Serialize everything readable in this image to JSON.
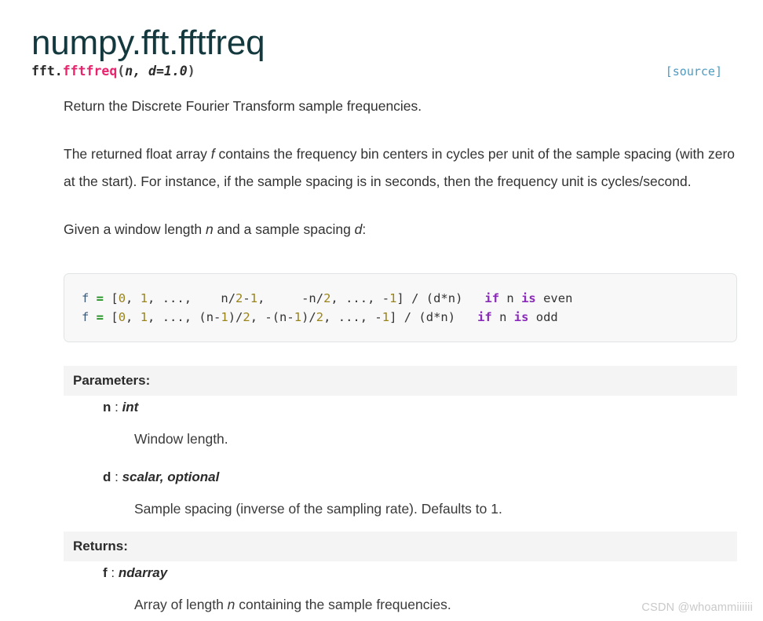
{
  "page": {
    "title": "numpy.fft.fftfreq"
  },
  "signature": {
    "prefix": "fft.",
    "function_name": "fftfreq",
    "open_paren": "(",
    "params": "n, d=1.0",
    "close_paren": ")",
    "source_label": "[source]"
  },
  "body": {
    "paragraphs": [
      {
        "id": "summary",
        "parts": [
          {
            "text": "Return the Discrete Fourier Transform sample frequencies.",
            "style": "normal"
          }
        ]
      },
      {
        "id": "description",
        "parts": [
          {
            "text": "The returned float array ",
            "style": "normal"
          },
          {
            "text": "f",
            "style": "italic"
          },
          {
            "text": " contains the frequency bin centers in cycles per unit of the sample spacing (with zero at the start). For instance, if the sample spacing is in seconds, then the frequency unit is cycles/second.",
            "style": "normal"
          }
        ]
      },
      {
        "id": "given",
        "parts": [
          {
            "text": "Given a window length ",
            "style": "normal"
          },
          {
            "text": "n",
            "style": "italic"
          },
          {
            "text": " and a sample spacing ",
            "style": "normal"
          },
          {
            "text": "d",
            "style": "italic"
          },
          {
            "text": ":",
            "style": "normal"
          }
        ]
      }
    ]
  },
  "code_block": {
    "lines": [
      [
        {
          "t": "f ",
          "c": "name"
        },
        {
          "t": "= ",
          "c": "op"
        },
        {
          "t": "[",
          "c": "plain"
        },
        {
          "t": "0",
          "c": "num"
        },
        {
          "t": ", ",
          "c": "plain"
        },
        {
          "t": "1",
          "c": "num"
        },
        {
          "t": ", ..., ",
          "c": "plain"
        },
        {
          "t": "   n/",
          "c": "plain"
        },
        {
          "t": "2",
          "c": "num"
        },
        {
          "t": "-",
          "c": "plain"
        },
        {
          "t": "1",
          "c": "num"
        },
        {
          "t": ",     -n/",
          "c": "plain"
        },
        {
          "t": "2",
          "c": "num"
        },
        {
          "t": ", ..., -",
          "c": "plain"
        },
        {
          "t": "1",
          "c": "num"
        },
        {
          "t": "] / (d*n)   ",
          "c": "plain"
        },
        {
          "t": "if",
          "c": "kw"
        },
        {
          "t": " n ",
          "c": "plain"
        },
        {
          "t": "is",
          "c": "kw"
        },
        {
          "t": " even",
          "c": "plain"
        }
      ],
      [
        {
          "t": "f ",
          "c": "name"
        },
        {
          "t": "= ",
          "c": "op"
        },
        {
          "t": "[",
          "c": "plain"
        },
        {
          "t": "0",
          "c": "num"
        },
        {
          "t": ", ",
          "c": "plain"
        },
        {
          "t": "1",
          "c": "num"
        },
        {
          "t": ", ..., (n-",
          "c": "plain"
        },
        {
          "t": "1",
          "c": "num"
        },
        {
          "t": ")/",
          "c": "plain"
        },
        {
          "t": "2",
          "c": "num"
        },
        {
          "t": ", -(n-",
          "c": "plain"
        },
        {
          "t": "1",
          "c": "num"
        },
        {
          "t": ")/",
          "c": "plain"
        },
        {
          "t": "2",
          "c": "num"
        },
        {
          "t": ", ..., -",
          "c": "plain"
        },
        {
          "t": "1",
          "c": "num"
        },
        {
          "t": "] / (d*n)   ",
          "c": "plain"
        },
        {
          "t": "if",
          "c": "kw"
        },
        {
          "t": " n ",
          "c": "plain"
        },
        {
          "t": "is",
          "c": "kw"
        },
        {
          "t": " odd",
          "c": "plain"
        }
      ]
    ],
    "plain_text_line_1": "f = [0, 1, ...,   n/2-1,     -n/2, ..., -1] / (d*n)   if n is even",
    "plain_text_line_2": "f = [0, 1, ..., (n-1)/2, -(n-1)/2, ..., -1] / (d*n)   if n is odd"
  },
  "parameters": {
    "heading": "Parameters:",
    "items": [
      {
        "name": "n",
        "separator": ":",
        "type": "int",
        "description_parts": [
          {
            "text": "Window length.",
            "style": "normal"
          }
        ]
      },
      {
        "name": "d",
        "separator": ":",
        "type": "scalar, optional",
        "description_parts": [
          {
            "text": "Sample spacing (inverse of the sampling rate). Defaults to 1.",
            "style": "normal"
          }
        ]
      }
    ]
  },
  "returns": {
    "heading": "Returns:",
    "items": [
      {
        "name": "f",
        "separator": ":",
        "type": "ndarray",
        "description_parts": [
          {
            "text": "Array of length ",
            "style": "normal"
          },
          {
            "text": "n",
            "style": "italic"
          },
          {
            "text": " containing the sample frequencies.",
            "style": "normal"
          }
        ]
      }
    ]
  },
  "watermark": {
    "text": "CSDN @whoammiiiiii"
  },
  "colors": {
    "title": "#13393f",
    "function_name": "#e8246e",
    "source_link": "#4b9cc4",
    "code_keyword": "#8a2ab8",
    "code_number": "#9a8419",
    "code_operator": "#1a8c1a",
    "code_name": "#3c5a78",
    "code_background": "#f8f8f8",
    "section_header_background": "#f4f4f4",
    "body_text": "#323232",
    "watermark": "#c9c9c9"
  }
}
